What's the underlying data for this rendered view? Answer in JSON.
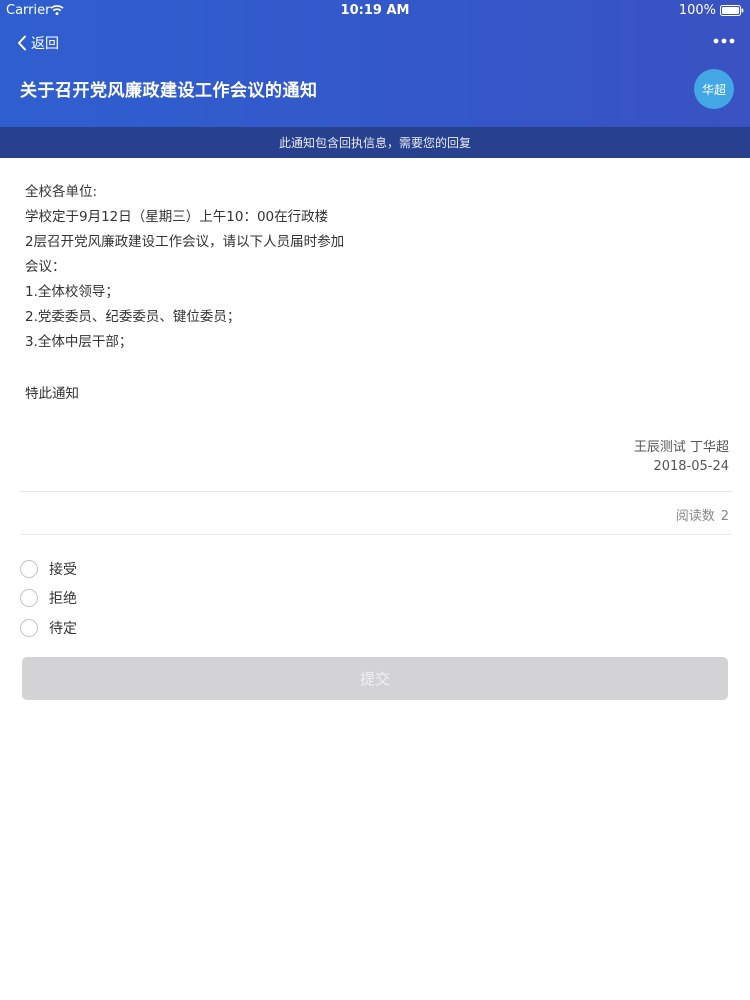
{
  "status_bar": {
    "carrier": "Carrier",
    "time": "10:19 AM",
    "battery": "100%"
  },
  "nav": {
    "back_label": "返回",
    "title": "关于召开党风廉政建设工作会议的通知",
    "avatar_text": "华超"
  },
  "banner": {
    "text": "此通知包含回执信息，需要您的回复"
  },
  "notice": {
    "lines": [
      "全校各单位:",
      "学校定于9月12日（星期三）上午10：00在行政楼",
      "2层召开党风廉政建设工作会议，请以下人员届时参加",
      "会议：",
      "1.全体校领导；",
      "2.党委委员、纪委委员、键位委员；",
      "3.全体中层干部；"
    ],
    "closing": "特此通知",
    "sender": "王辰测试 丁华超",
    "date": "2018-05-24"
  },
  "read_count": {
    "label": "阅读数",
    "value": "2"
  },
  "reply_options": [
    "接受",
    "拒绝",
    "待定"
  ],
  "submit_label": "提交",
  "colors": {
    "header": "#3457c9",
    "banner": "#28418e",
    "avatar": "#43a7e6",
    "submit_disabled": "#d3d3d6"
  }
}
